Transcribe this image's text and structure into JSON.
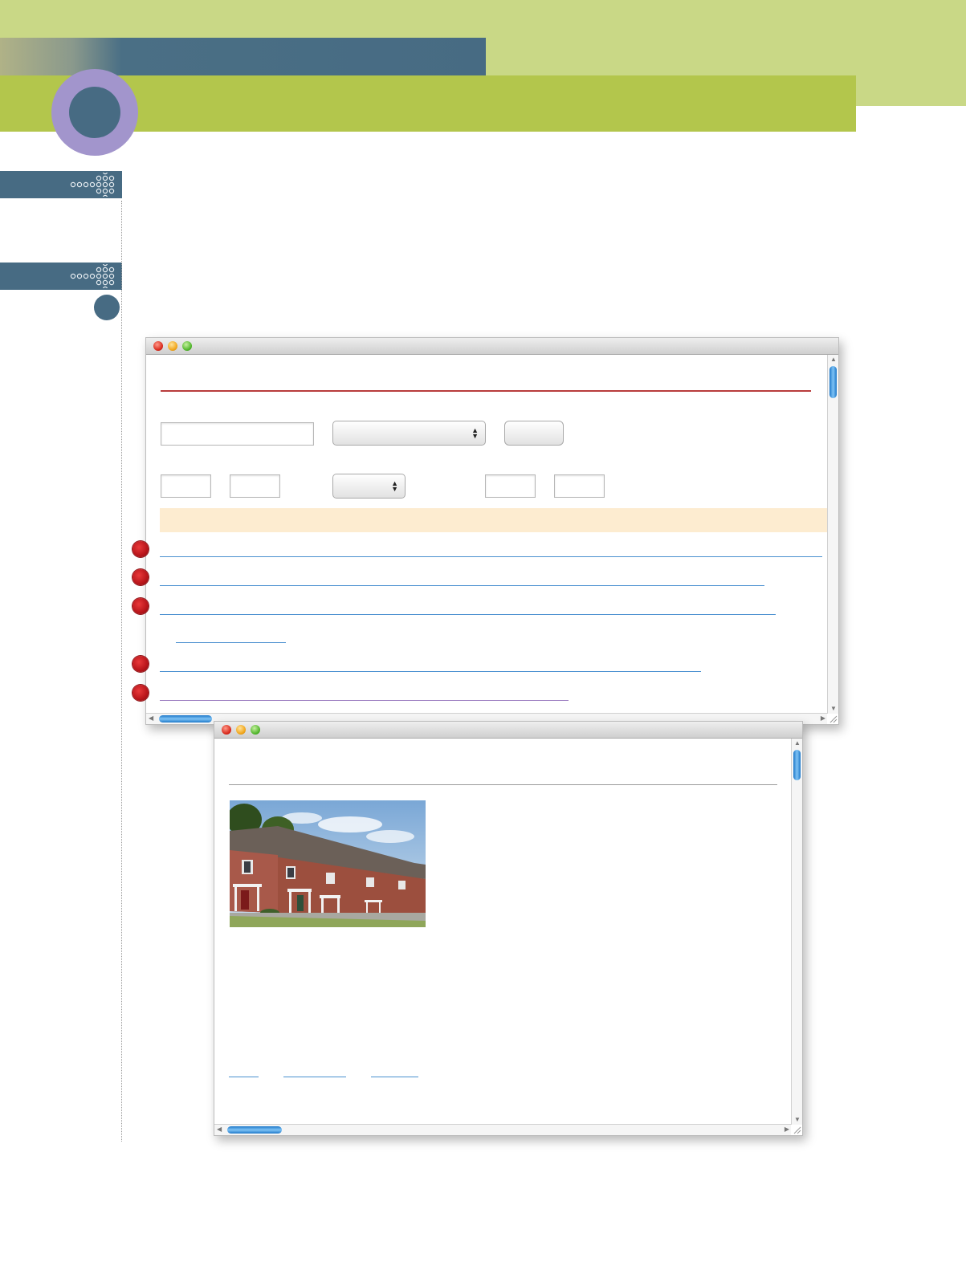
{
  "page": {
    "background": "#ffffff",
    "colors": {
      "header_light_green": "#c9d886",
      "header_green": "#b3c64c",
      "header_blue": "#476b83",
      "circle_purple": "#a295cc",
      "banner_cream": "#fdecd0",
      "heading_rule_red": "#b83c3c",
      "link_blue": "#4a90d0",
      "visited_link_purple": "#9b7cc0",
      "bullet_red": "#c8181c"
    }
  },
  "icons": {
    "side_tab_ornament": "dotted-arrow-icon",
    "window_close": "close-light-icon",
    "window_minimize": "minimize-light-icon",
    "window_zoom": "zoom-light-icon",
    "bullet": "red-bullet-icon",
    "scroll_up": "scroll-up-arrow-icon",
    "scroll_down": "scroll-down-arrow-icon",
    "scroll_left": "scroll-left-arrow-icon",
    "scroll_right": "scroll-right-arrow-icon",
    "resize_grip": "resize-grip-icon"
  },
  "window_search": {
    "search_field_value": "",
    "search_popup_selected": "",
    "search_button_label": "",
    "min_field_value": "",
    "max_field_value": "",
    "small_popup_selected": "",
    "from_field_value": "",
    "to_field_value": "",
    "results_banner_text": "",
    "scroll_position": {
      "vertical": 0.05,
      "horizontal": 0.0
    }
  },
  "window_listing": {
    "photo_description_alt": "Row of brick townhouses",
    "scroll_position": {
      "vertical": 0.03,
      "horizontal": 0.05
    }
  }
}
